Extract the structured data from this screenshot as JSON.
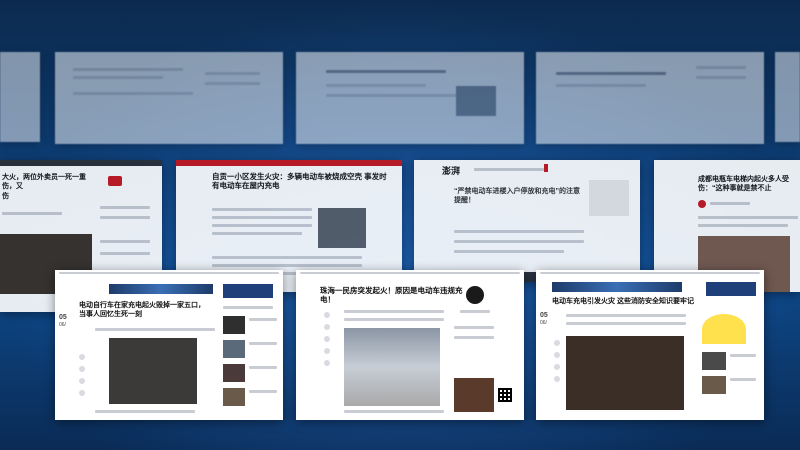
{
  "screens": {
    "s1_title": "自贡一小区发生火灾：多辆电动车被烧成空壳 事发时有电动车在屋内充电",
    "s2_logo": "澎湃",
    "s2_title": "“严禁电动车进楼入户停放和充电”的注意提醒！",
    "s3_title": "成都电瓶车电梯内起火多人受伤：“这种事就是禁不止",
    "s4_title": "电动自行车在家充电起火毁掉一家五口，当事人回忆生死一刻",
    "s4_date_day": "05",
    "s4_date_month": "06/",
    "s5_title": "珠海一民房突发起火！原因是电动车违规充电！",
    "s6_title": "电动车充电引发火灾 这些消防安全知识要牢记",
    "s6_date_day": "05",
    "s6_date_month": "06/",
    "left_partial_title": "大火，两位外卖员一死一重伤，又",
    "left_partial_title2": "伤"
  },
  "colors": {
    "accent_red": "#c8161d",
    "background": "#0d3f78"
  }
}
